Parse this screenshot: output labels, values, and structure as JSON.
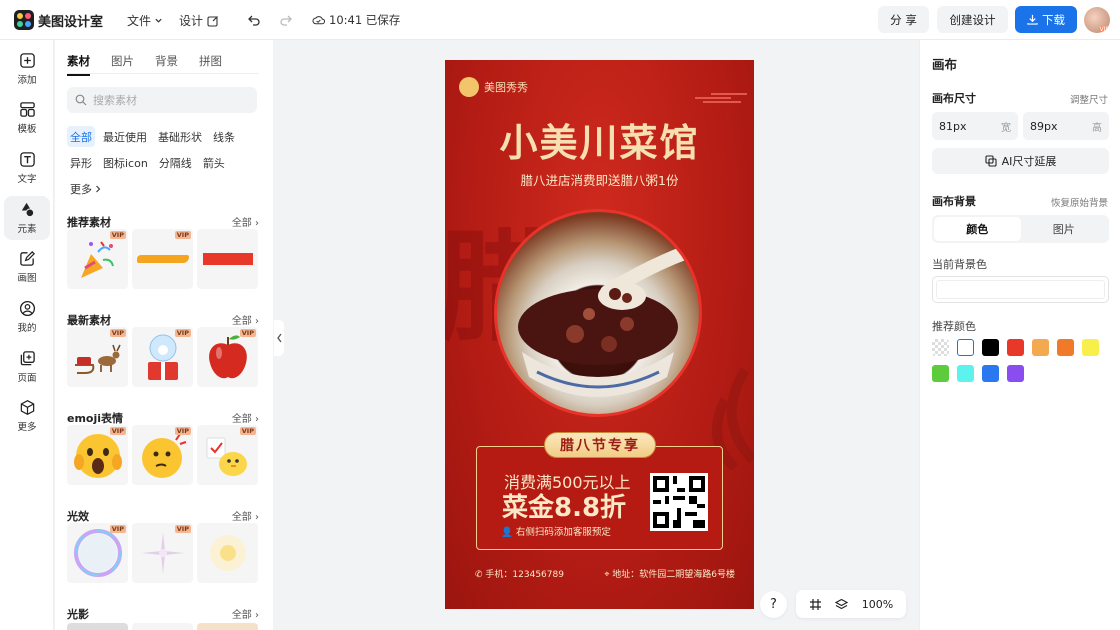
{
  "app": {
    "name": "美图设计室"
  },
  "menu": {
    "file": "文件",
    "design": "设计",
    "save_status": "10:41 已保存"
  },
  "toolbar": {
    "share": "分 享",
    "create": "创建设计",
    "download": "下载",
    "vip": "VIP"
  },
  "rail": [
    {
      "label": "添加",
      "icon": "plus-square-icon"
    },
    {
      "label": "模板",
      "icon": "template-icon"
    },
    {
      "label": "文字",
      "icon": "text-icon"
    },
    {
      "label": "元素",
      "icon": "shapes-icon",
      "active": true
    },
    {
      "label": "画图",
      "icon": "edit-icon"
    },
    {
      "label": "我的",
      "icon": "user-icon"
    },
    {
      "label": "页面",
      "icon": "add-page-icon"
    },
    {
      "label": "更多",
      "icon": "cube-icon"
    }
  ],
  "panel": {
    "tabs": [
      "素材",
      "图片",
      "背景",
      "拼图"
    ],
    "search_placeholder": "搜索素材",
    "chips": [
      "全部",
      "最近使用",
      "基础形状",
      "线条",
      "异形",
      "图标icon",
      "分隔线",
      "箭头",
      "更多"
    ],
    "all_label": "全部",
    "vip": "VIP",
    "sections": [
      {
        "title": "推荐素材",
        "items": [
          "party-popper",
          "brush-stroke",
          "red-bar"
        ]
      },
      {
        "title": "最新素材",
        "items": [
          "reindeer-sleigh",
          "snow-globe",
          "red-apple"
        ]
      },
      {
        "title": "emoji表情",
        "items": [
          "shocked-emoji",
          "thinking-emoji",
          "chick-emoji"
        ]
      },
      {
        "title": "光效",
        "items": [
          "bubble-ring",
          "sparkle",
          "glow"
        ]
      },
      {
        "title": "光影",
        "items": []
      }
    ]
  },
  "poster": {
    "brand": "美图秀秀",
    "title": "小美川菜馆",
    "subtitle": "腊八进店消费即送腊八粥1份",
    "bg_char": "腊",
    "badge": "腊八节专享",
    "offer_line1": "消费满500元以上",
    "offer_line2": "菜金8.8折",
    "offer_line3": "右侧扫码添加客服预定",
    "phone": "手机：123456789",
    "address": "地址：软件园二期望海路6号楼"
  },
  "zoom": {
    "help": "?",
    "level": "100%"
  },
  "props": {
    "title": "画布",
    "size_label": "画布尺寸",
    "resize_link": "调整尺寸",
    "width_value": "81px",
    "width_unit": "宽",
    "height_value": "89px",
    "height_unit": "高",
    "ai_extend": "AI尺寸延展",
    "bg_label": "画布背景",
    "restore_link": "恢复原始背景",
    "bg_tabs": [
      "颜色",
      "图片"
    ],
    "current_bg_label": "当前背景色",
    "recommend_label": "推荐颜色",
    "swatches": [
      "transparent",
      "#ffffff",
      "#000000",
      "#e8382a",
      "#f3a94f",
      "#f07a2a",
      "#f9ef4a",
      "#5ccb3c",
      "#5ef2ee",
      "#2a78f0",
      "#8a4ef0"
    ]
  }
}
